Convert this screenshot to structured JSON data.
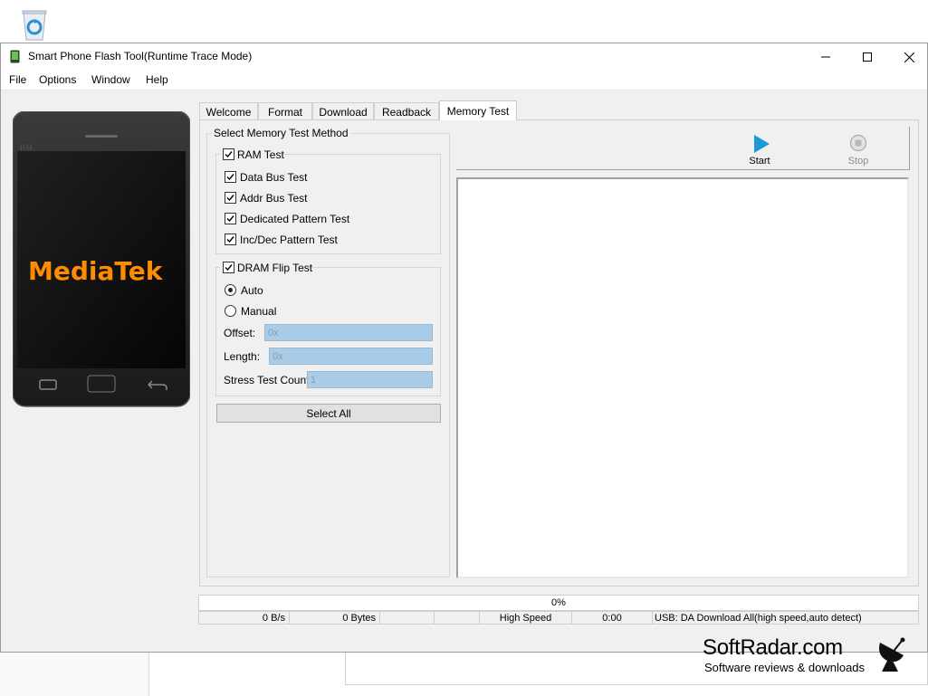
{
  "window": {
    "title": "Smart Phone Flash Tool(Runtime Trace Mode)"
  },
  "menu": {
    "items": [
      "File",
      "Options",
      "Window",
      "Help"
    ]
  },
  "phone": {
    "brand": "MediaTek",
    "top_label": "BM"
  },
  "tabs": [
    {
      "label": "Welcome"
    },
    {
      "label": "Format"
    },
    {
      "label": "Download"
    },
    {
      "label": "Readback"
    },
    {
      "label": "Memory Test",
      "active": true
    }
  ],
  "memory_test": {
    "group_title": "Select Memory Test Method",
    "ram_test": {
      "label": "RAM Test",
      "checked": true,
      "items": [
        {
          "label": "Data Bus Test",
          "checked": true
        },
        {
          "label": "Addr Bus Test",
          "checked": true
        },
        {
          "label": "Dedicated Pattern Test",
          "checked": true
        },
        {
          "label": "Inc/Dec Pattern Test",
          "checked": true
        }
      ]
    },
    "dram_flip": {
      "label": "DRAM Flip Test",
      "checked": true,
      "mode_auto": "Auto",
      "mode_manual": "Manual",
      "selected_mode": "Auto",
      "offset_label": "Offset:",
      "offset_value": "0x",
      "length_label": "Length:",
      "length_value": "0x",
      "stress_label": "Stress Test Count",
      "stress_value": "1"
    },
    "select_all": "Select All",
    "start": "Start",
    "stop": "Stop"
  },
  "status": {
    "progress_text": "0%",
    "progress_fraction": 0,
    "speed": "0 B/s",
    "bytes": "0 Bytes",
    "usb_speed": "High Speed",
    "time": "0:00",
    "usb_info": "USB: DA Download All(high speed,auto detect)"
  },
  "watermark": {
    "title": "SoftRadar.com",
    "subtitle": "Software reviews & downloads"
  },
  "colors": {
    "field_bg": "#a9cde8",
    "play_blue": "#1a9ad6",
    "brand_orange": "#ff8c00"
  }
}
